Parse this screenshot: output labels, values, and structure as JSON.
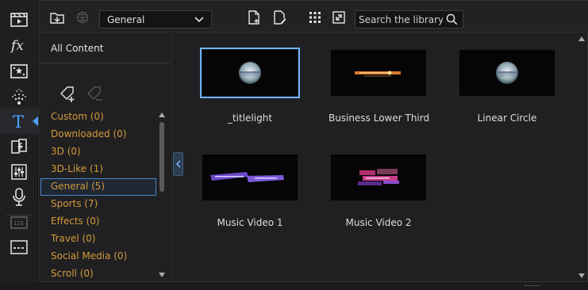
{
  "toolbar": {
    "category_value": "General",
    "search_placeholder": "Search the library"
  },
  "rail": {
    "items": [
      {
        "name": "media-room-icon",
        "active": false
      },
      {
        "name": "fx-room-icon",
        "active": false
      },
      {
        "name": "pip-room-icon",
        "active": false
      },
      {
        "name": "particle-room-icon",
        "active": false
      },
      {
        "name": "title-room-icon",
        "active": true
      },
      {
        "name": "transition-room-icon",
        "active": false
      },
      {
        "name": "audio-mixing-room-icon",
        "active": false
      },
      {
        "name": "voiceover-room-icon",
        "active": false
      },
      {
        "name": "chapter-room-icon",
        "active": false
      },
      {
        "name": "subtitle-room-icon",
        "active": false
      }
    ]
  },
  "sidebar": {
    "all_content_label": "All Content",
    "categories": [
      {
        "label": "Custom  (0)",
        "selected": false
      },
      {
        "label": "Downloaded  (0)",
        "selected": false
      },
      {
        "label": "3D  (0)",
        "selected": false
      },
      {
        "label": "3D-Like  (1)",
        "selected": false
      },
      {
        "label": "General  (5)",
        "selected": true
      },
      {
        "label": "Sports  (7)",
        "selected": false
      },
      {
        "label": "Effects  (0)",
        "selected": false
      },
      {
        "label": "Travel  (0)",
        "selected": false
      },
      {
        "label": "Social Media  (0)",
        "selected": false
      },
      {
        "label": "Scroll  (0)",
        "selected": false
      }
    ]
  },
  "library": {
    "items": [
      {
        "label": "_titlelight",
        "selected": true,
        "thumb": "globe"
      },
      {
        "label": "Business Lower Third",
        "selected": false,
        "thumb": "bar-orange"
      },
      {
        "label": "Linear Circle",
        "selected": false,
        "thumb": "globe"
      },
      {
        "label": "Music Video 1",
        "selected": false,
        "thumb": "ribbon-purple"
      },
      {
        "label": "Music Video 2",
        "selected": false,
        "thumb": "glitch-pink"
      }
    ]
  },
  "colors": {
    "accent": "#4aa3ff",
    "category_text": "#d39a3a",
    "selection_border": "#6eb3ff"
  }
}
